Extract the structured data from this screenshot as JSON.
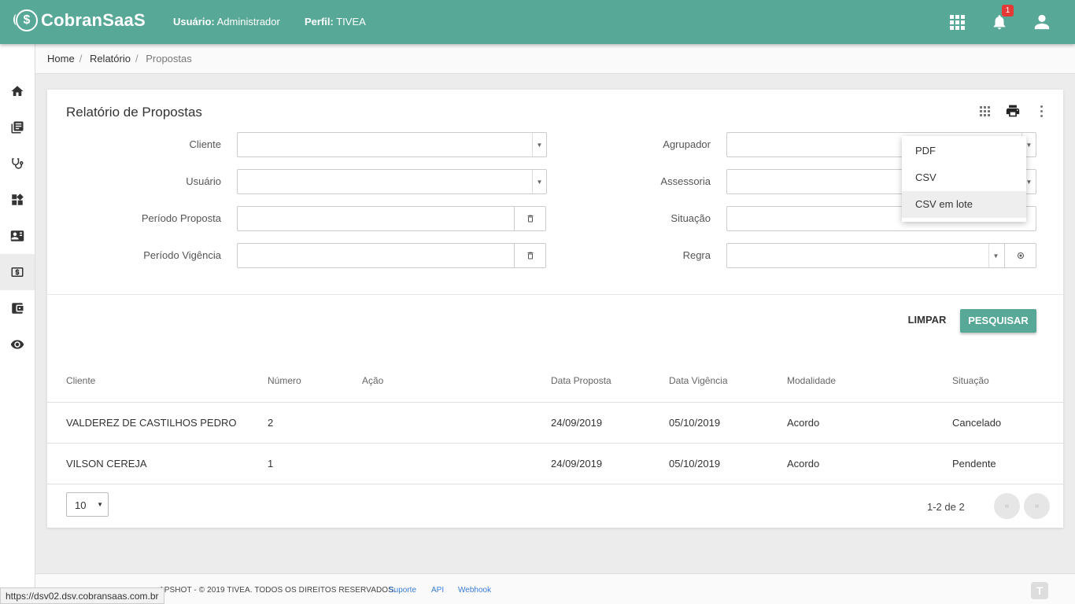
{
  "header": {
    "logo_text": "CobranSaaS",
    "user_label": "Usuário:",
    "user_value": "Administrador",
    "profile_label": "Perfil:",
    "profile_value": "TIVEA",
    "notification_count": "1",
    "color": "#58a898"
  },
  "sidebar": {
    "items": [
      "home-icon",
      "book-icon",
      "stethoscope-icon",
      "dashboard-icon",
      "contact-card-icon",
      "money-icon",
      "wallet-icon",
      "eye-icon"
    ],
    "active_index": 5
  },
  "breadcrumb": {
    "home": "Home",
    "relatorio": "Relatório",
    "current": "Propostas"
  },
  "card": {
    "title": "Relatório de Propostas"
  },
  "form": {
    "cliente": "Cliente",
    "usuario": "Usuário",
    "periodo_proposta": "Período Proposta",
    "periodo_vigencia": "Período Vigência",
    "agrupador": "Agrupador",
    "assessoria": "Assessoria",
    "situacao": "Situação",
    "regra": "Regra"
  },
  "actions": {
    "clear": "LIMPAR",
    "search": "PESQUISAR"
  },
  "export_menu": {
    "items": [
      "PDF",
      "CSV",
      "CSV em lote"
    ],
    "hovered_index": 2
  },
  "table": {
    "headers": [
      "Cliente",
      "Número",
      "Ação",
      "Data Proposta",
      "Data Vigência",
      "Modalidade",
      "Situação"
    ],
    "rows": [
      [
        "VALDEREZ DE CASTILHOS PEDRO",
        "2",
        "",
        "24/09/2019",
        "05/10/2019",
        "Acordo",
        "Cancelado"
      ],
      [
        "VILSON CEREJA",
        "1",
        "",
        "24/09/2019",
        "05/10/2019",
        "Acordo",
        "Pendente"
      ]
    ]
  },
  "pagination": {
    "page_size": "10",
    "range": "1-2",
    "of_label": "de",
    "total": "2",
    "prev": "«",
    "next": "»"
  },
  "footer": {
    "copyright": "APSHOT - © 2019 TIVEA. TODOS OS DIREITOS RESERVADOS.",
    "links": [
      "Suporte",
      "API",
      "Webhook"
    ]
  },
  "status_url": "https://dsv02.dsv.cobransaas.com.br"
}
